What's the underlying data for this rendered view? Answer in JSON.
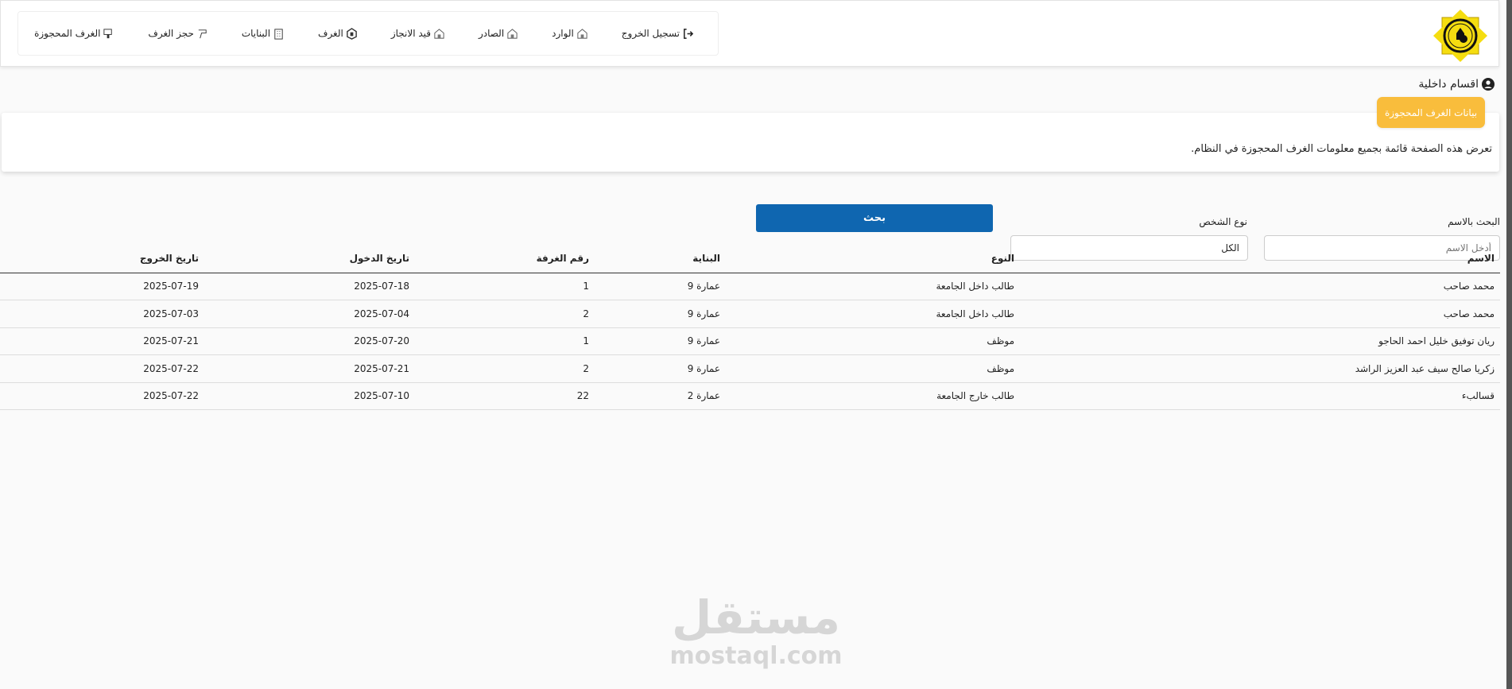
{
  "nav": [
    {
      "label": "الغرف المحجوزة",
      "icon": "booked-rooms-icon"
    },
    {
      "label": "حجز الغرف",
      "icon": "book-room-icon"
    },
    {
      "label": "البنايات",
      "icon": "building-icon"
    },
    {
      "label": "الغرف",
      "icon": "rooms-icon"
    },
    {
      "label": "قيد الانجاز",
      "icon": "house-icon"
    },
    {
      "label": "الصادر",
      "icon": "house-icon"
    },
    {
      "label": "الوارد",
      "icon": "house-icon"
    },
    {
      "label": "تسجيل الخروج",
      "icon": "logout-icon"
    }
  ],
  "section": "اقسام داخلية",
  "card": {
    "badge": "بيانات الغرف المحجوزة",
    "description": "تعرض هذه الصفحة قائمة بجميع معلومات الغرف المحجوزة في النظام."
  },
  "filters": {
    "name_label": "البحث بالاسم",
    "name_placeholder": "أدخل الاسم",
    "type_label": "نوع الشخص",
    "type_value": "الكل",
    "search_button": "بحث"
  },
  "table": {
    "headers": [
      "الاسم",
      "النوع",
      "البناية",
      "رقم الغرفة",
      "تاريخ الدخول",
      "تاريخ الخروج"
    ],
    "rows": [
      [
        "محمد صاحب",
        "طالب داخل الجامعة",
        "عمارة 9",
        "1",
        "2025-07-18",
        "2025-07-19"
      ],
      [
        "محمد صاحب",
        "طالب داخل الجامعة",
        "عمارة 9",
        "2",
        "2025-07-04",
        "2025-07-03"
      ],
      [
        "ريان توفيق خليل احمد الحاجو",
        "موظف",
        "عمارة 9",
        "1",
        "2025-07-20",
        "2025-07-21"
      ],
      [
        "زكريا صالح سيف عبد العزيز الراشد",
        "موظف",
        "عمارة 9",
        "2",
        "2025-07-21",
        "2025-07-22"
      ],
      [
        "قسالبء",
        "طالب خارج الجامعة",
        "عمارة 2",
        "22",
        "2025-07-10",
        "2025-07-22"
      ]
    ]
  },
  "watermark": {
    "arabic": "مستقل",
    "latin": "mostaql.com"
  },
  "colors": {
    "accent": "#f9bd3c",
    "button": "#0f66b0"
  }
}
